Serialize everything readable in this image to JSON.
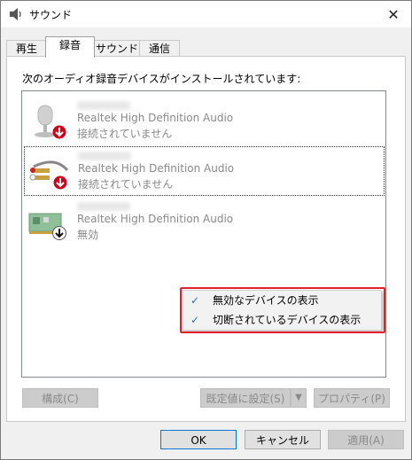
{
  "window": {
    "title": "サウンド",
    "close_glyph": "✕"
  },
  "tabs": [
    {
      "label": "再生"
    },
    {
      "label": "録音"
    },
    {
      "label": "サウンド"
    },
    {
      "label": "通信"
    }
  ],
  "panel": {
    "instruction": "次のオーディオ録音デバイスがインストールされています:"
  },
  "devices": [
    {
      "icon": "microphone-icon",
      "description": "Realtek High Definition Audio",
      "status": "接続されていません",
      "badge_icon": "red-down-arrow-icon"
    },
    {
      "icon": "line-in-cable-icon",
      "description": "Realtek High Definition Audio",
      "status": "接続されていません",
      "badge_icon": "red-down-arrow-icon"
    },
    {
      "icon": "sound-card-icon",
      "description": "Realtek High Definition Audio",
      "status": "無効",
      "badge_icon": "black-down-arrow-icon"
    }
  ],
  "context_menu": {
    "items": [
      {
        "label": "無効なデバイスの表示",
        "checked": true
      },
      {
        "label": "切断されているデバイスの表示",
        "checked": true
      }
    ],
    "check_glyph": "✓",
    "highlight_color": "#e5202a"
  },
  "buttons": {
    "configure": "構成(C)",
    "set_default": "既定値に設定(S)",
    "properties": "プロパティ(P)",
    "ok": "OK",
    "cancel": "キャンセル",
    "apply": "適用(A)",
    "split_arrow": "▼"
  }
}
